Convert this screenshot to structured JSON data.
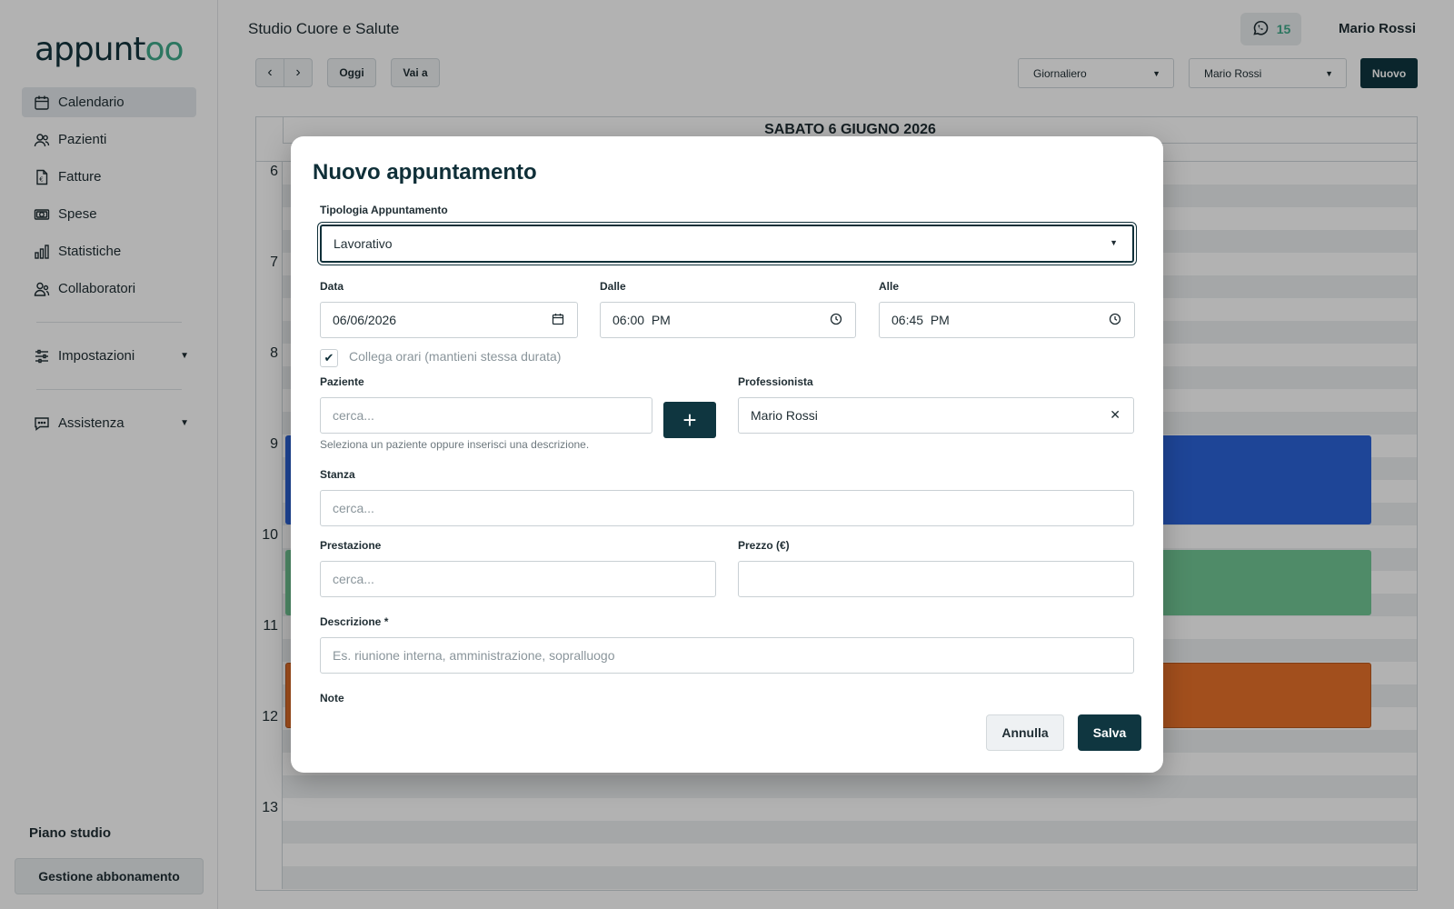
{
  "app": {
    "logo_main": "appunt",
    "logo_accent": "oo",
    "studio_name": "Studio Cuore e Salute",
    "whatsapp_count": "15",
    "user_name": "Mario Rossi",
    "brand_color": "#0f3640",
    "accent_color": "#3fa98a"
  },
  "sidebar": {
    "items": [
      {
        "label": "Calendario",
        "icon": "calendar-icon",
        "active": true
      },
      {
        "label": "Pazienti",
        "icon": "users-icon"
      },
      {
        "label": "Fatture",
        "icon": "invoice-icon"
      },
      {
        "label": "Spese",
        "icon": "money-icon"
      },
      {
        "label": "Statistiche",
        "icon": "bar-chart-icon"
      },
      {
        "label": "Collaboratori",
        "icon": "team-icon"
      }
    ],
    "settings_label": "Impostazioni",
    "support_label": "Assistenza",
    "plan_title": "Piano studio",
    "plan_button": "Gestione abbonamento"
  },
  "toolbar": {
    "prev": "‹",
    "next": "›",
    "today": "Oggi",
    "goto": "Vai a",
    "view_select": "Giornaliero",
    "professional_select": "Mario Rossi",
    "new_button": "Nuovo"
  },
  "calendar": {
    "date_header": "SABATO 6 GIUGNO 2026",
    "hours": [
      "6",
      "7",
      "8",
      "9",
      "10",
      "11",
      "12",
      "13"
    ],
    "event_colors": {
      "blue": "#2b63d9",
      "green": "#72c796",
      "orange": "#e8712a"
    }
  },
  "modal": {
    "title": "Nuovo appuntamento",
    "type_label": "Tipologia Appuntamento",
    "type_value": "Lavorativo",
    "date_label": "Data",
    "date_value": "06/06/2026",
    "from_label": "Dalle",
    "from_value": "06:00  PM",
    "to_label": "Alle",
    "to_value": "06:45  PM",
    "link_checkbox_label": "Collega orari (mantieni stessa durata)",
    "link_checked": true,
    "patient_label": "Paziente",
    "patient_placeholder": "cerca...",
    "patient_help": "Seleziona un paziente oppure inserisci una descrizione.",
    "professional_label": "Professionista",
    "professional_value": "Mario Rossi",
    "room_label": "Stanza",
    "room_placeholder": "cerca...",
    "service_label": "Prestazione",
    "service_placeholder": "cerca...",
    "price_label": "Prezzo (€)",
    "price_value": "",
    "description_label": "Descrizione *",
    "description_placeholder": "Es. riunione interna, amministrazione, sopralluogo",
    "notes_label": "Note",
    "cancel_button": "Annulla",
    "save_button": "Salva"
  }
}
